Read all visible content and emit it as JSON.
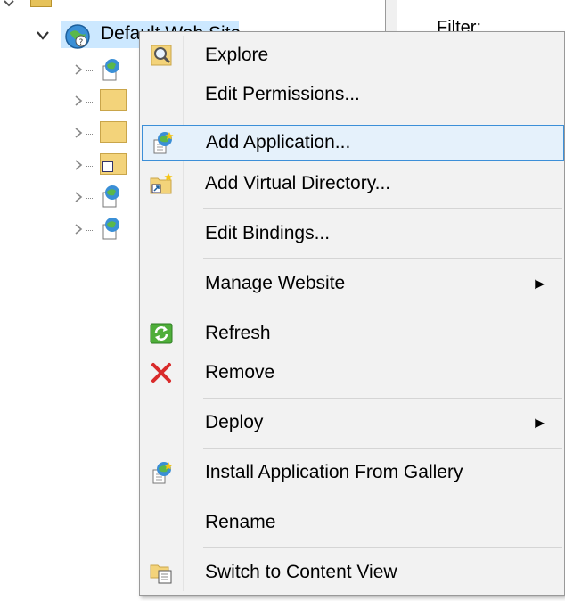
{
  "tree": {
    "selected_site_label": "Default Web Site",
    "filter_label": "Filter:"
  },
  "menu": {
    "items": [
      {
        "label": "Explore",
        "icon": "explore-icon"
      },
      {
        "label": "Edit Permissions...",
        "icon": ""
      },
      {
        "label": "Add Application...",
        "icon": "add-application-icon",
        "highlighted": true
      },
      {
        "label": "Add Virtual Directory...",
        "icon": "virtual-directory-icon"
      },
      {
        "label": "Edit Bindings...",
        "icon": ""
      },
      {
        "label": "Manage Website",
        "icon": "",
        "submenu": true
      },
      {
        "label": "Refresh",
        "icon": "refresh-icon"
      },
      {
        "label": "Remove",
        "icon": "remove-icon"
      },
      {
        "label": "Deploy",
        "icon": "",
        "submenu": true
      },
      {
        "label": "Install Application From Gallery",
        "icon": "install-gallery-icon"
      },
      {
        "label": "Rename",
        "icon": ""
      },
      {
        "label": "Switch to Content View",
        "icon": "content-view-icon"
      }
    ],
    "submenu_arrow": "▶"
  },
  "colors": {
    "highlight_bg": "#e5f1fb",
    "highlight_border": "#3c8fd8",
    "menu_bg": "#f2f2f2",
    "tree_selection": "#cce8ff",
    "remove_red": "#d92b2b"
  }
}
